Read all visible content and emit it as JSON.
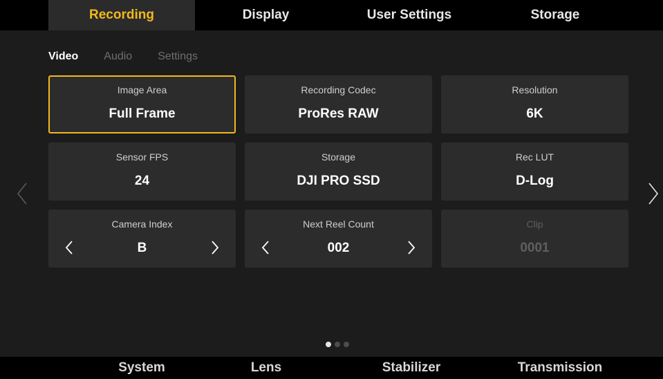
{
  "top_tabs": [
    {
      "label": "Recording",
      "active": true
    },
    {
      "label": "Display",
      "active": false
    },
    {
      "label": "User Settings",
      "active": false
    },
    {
      "label": "Storage",
      "active": false
    }
  ],
  "sub_tabs": [
    {
      "label": "Video",
      "active": true
    },
    {
      "label": "Audio",
      "active": false
    },
    {
      "label": "Settings",
      "active": false
    }
  ],
  "tiles": [
    {
      "label": "Image Area",
      "value": "Full Frame",
      "selected": true
    },
    {
      "label": "Recording Codec",
      "value": "ProRes RAW"
    },
    {
      "label": "Resolution",
      "value": "6K"
    },
    {
      "label": "Sensor FPS",
      "value": "24"
    },
    {
      "label": "Storage",
      "value": "DJI PRO SSD"
    },
    {
      "label": "Rec LUT",
      "value": "D-Log"
    },
    {
      "label": "Camera Index",
      "value": "B",
      "stepper": true
    },
    {
      "label": "Next Reel Count",
      "value": "002",
      "stepper": true
    },
    {
      "label": "Clip",
      "value": "0001",
      "disabled": true
    }
  ],
  "pagination": {
    "pages": 3,
    "current": 1
  },
  "bottom_tabs": [
    "System",
    "Lens",
    "Stabilizer",
    "Transmission"
  ],
  "colors": {
    "accent": "#f2b81c",
    "tile_bg": "#2c2c2c",
    "bar_bg": "#000000"
  }
}
